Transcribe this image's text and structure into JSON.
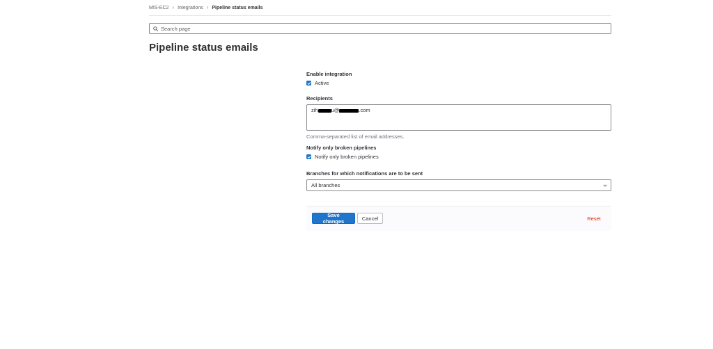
{
  "breadcrumb": {
    "items": [
      "MIS-EC2",
      "Integrations",
      "Pipeline status emails"
    ]
  },
  "search": {
    "placeholder": "Search page"
  },
  "page": {
    "title": "Pipeline status emails"
  },
  "form": {
    "enable_integration": {
      "label": "Enable integration",
      "checkbox_label": "Active",
      "checked": true
    },
    "recipients": {
      "label": "Recipients",
      "value_prefix": "zih",
      "value_middle": "u@",
      "value_suffix": ".com",
      "help": "Comma-separated list of email addresses."
    },
    "notify_only_broken": {
      "label": "Notify only broken pipelines",
      "checkbox_label": "Notify only broken pipelines",
      "checked": true
    },
    "branches": {
      "label": "Branches for which notifications are to be sent",
      "selected": "All branches"
    }
  },
  "actions": {
    "save_label": "Save changes",
    "cancel_label": "Cancel",
    "reset_label": "Reset"
  },
  "colors": {
    "primary": "#1f75cb",
    "danger": "#dd2b0e"
  },
  "icons": {
    "search": "search-icon",
    "chevron": "chevron-down-icon",
    "check": "checkmark-icon"
  }
}
